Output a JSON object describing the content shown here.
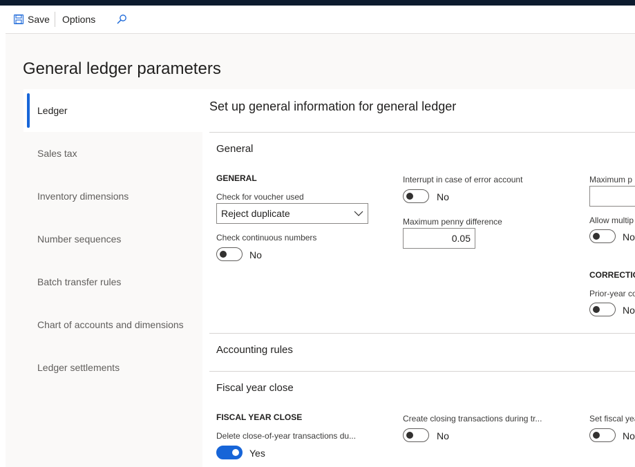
{
  "action_pane": {
    "save_label": "Save",
    "options_label": "Options"
  },
  "page": {
    "title": "General ledger parameters"
  },
  "nav": {
    "items": [
      {
        "label": "Ledger",
        "selected": true
      },
      {
        "label": "Sales tax",
        "selected": false
      },
      {
        "label": "Inventory dimensions",
        "selected": false
      },
      {
        "label": "Number sequences",
        "selected": false
      },
      {
        "label": "Batch transfer rules",
        "selected": false
      },
      {
        "label": "Chart of accounts and dimensions",
        "selected": false
      },
      {
        "label": "Ledger settlements",
        "selected": false
      }
    ]
  },
  "content": {
    "title": "Set up general information for general ledger",
    "general": {
      "title": "General",
      "group_title": "GENERAL",
      "check_voucher_label": "Check for voucher used",
      "check_voucher_value": "Reject duplicate",
      "check_continuous_label": "Check continuous numbers",
      "check_continuous_value": "No",
      "interrupt_label": "Interrupt in case of error account",
      "interrupt_value": "No",
      "max_penny_label": "Maximum penny difference",
      "max_penny_value": "0.05",
      "max_p_label": "Maximum p",
      "allow_multi_label": "Allow multip",
      "allow_multi_value": "No",
      "correction_group": "CORRECTIO",
      "prior_year_label": "Prior-year co",
      "prior_year_value": "No"
    },
    "accounting_rules": {
      "title": "Accounting rules"
    },
    "fiscal_year_close": {
      "title": "Fiscal year close",
      "group_title": "FISCAL YEAR CLOSE",
      "delete_label": "Delete close-of-year transactions du...",
      "delete_value": "Yes",
      "create_label": "Create closing transactions during tr...",
      "create_value": "No",
      "set_fiscal_label": "Set fiscal yea",
      "set_fiscal_value": "No"
    }
  },
  "colors": {
    "accent": "#1765d8",
    "topbar": "#0c1b2e"
  }
}
